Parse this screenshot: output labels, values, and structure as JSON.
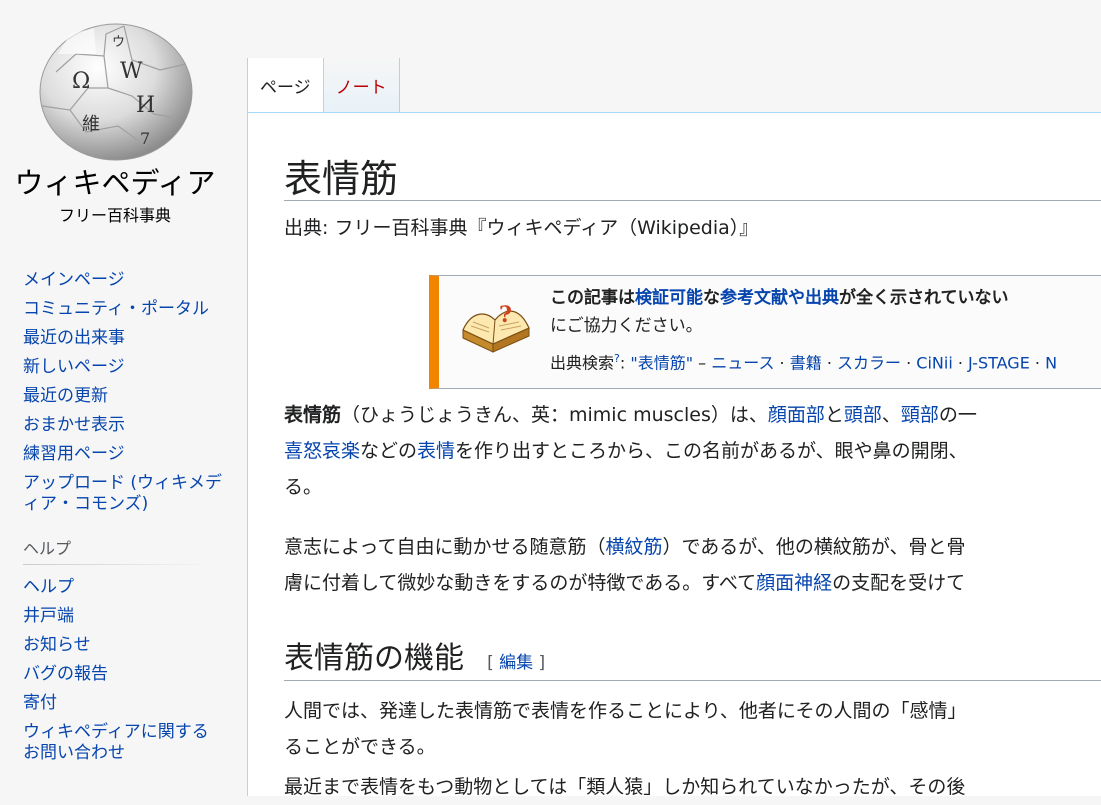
{
  "logo": {
    "title": "ウィキペディア",
    "subtitle": "フリー百科事典",
    "globe_glyphs": [
      "Ω",
      "W",
      "И",
      "維",
      "ウ",
      "7"
    ]
  },
  "sidebar": {
    "nav_items": [
      {
        "label": "メインページ"
      },
      {
        "label": "コミュニティ・ポータル"
      },
      {
        "label": "最近の出来事"
      },
      {
        "label": "新しいページ"
      },
      {
        "label": "最近の更新"
      },
      {
        "label": "おまかせ表示"
      },
      {
        "label": "練習用ページ"
      },
      {
        "label": "アップロード (ウィキメディア・コモンズ)"
      }
    ],
    "help_heading": "ヘルプ",
    "help_items": [
      {
        "label": "ヘルプ"
      },
      {
        "label": "井戸端"
      },
      {
        "label": "お知らせ"
      },
      {
        "label": "バグの報告"
      },
      {
        "label": "寄付"
      },
      {
        "label": "ウィキペディアに関するお問い合わせ"
      }
    ]
  },
  "tabs": [
    {
      "label": "ページ",
      "selected": true
    },
    {
      "label": "ノート",
      "selected": false
    }
  ],
  "article": {
    "title": "表情筋",
    "site_sub": "出典: フリー百科事典『ウィキペディア（Wikipedia）』",
    "ambox": {
      "l1_a": "この記事は",
      "l1_b": "検証可能",
      "l1_c": "な",
      "l1_d": "参考文献や出典",
      "l1_e": "が全く示されていない",
      "line2": "にご協力ください。",
      "search_label": "出典検索",
      "search_sup": "?",
      "search_colon": ": ",
      "search_term": "\"表情筋\"",
      "dash": " – ",
      "search_links": [
        "ニュース",
        "書籍",
        "スカラー",
        "CiNii",
        "J-STAGE",
        "N"
      ],
      "sep": " · "
    },
    "p1": {
      "bold": "表情筋",
      "t1": "（ひょうじょうきん、英：mimic muscles）は、",
      "l1": "顔面部",
      "t2": "と",
      "l2": "頭部",
      "t3": "、",
      "l3": "頸部",
      "t4": "の一",
      "l4": "喜怒哀楽",
      "t5": "などの",
      "l5": "表情",
      "t6": "を作り出すところから、この名前があるが、眼や鼻の開閉、",
      "t7": "る。"
    },
    "p2": {
      "t1": "意志によって自由に動かせる随意筋（",
      "l1": "横紋筋",
      "t2": "）であるが、他の横紋筋が、骨と骨",
      "t3": "膚に付着して微妙な動きをするのが特徴である。すべて",
      "l2": "顔面神経",
      "t4": "の支配を受けて"
    },
    "section": {
      "title": "表情筋の機能",
      "edit_open": "[ ",
      "edit_label": "編集",
      "edit_close": " ]"
    },
    "p3": {
      "line1": "人間では、発達した表情筋で表情を作ることにより、他者にその人間の「感情」",
      "line2": "ることができる。"
    },
    "p4": {
      "line1": "最近まで表情をもつ動物としては「類人猿」しか知られていなかったが、その後"
    }
  },
  "colors": {
    "link": "#0645ad",
    "new_link": "#ba0000",
    "ambox_accent": "#f28500",
    "border": "#a7d7f9"
  }
}
